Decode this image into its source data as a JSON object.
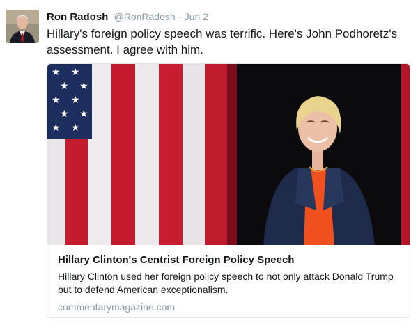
{
  "tweet": {
    "author_name": "Ron Radosh",
    "handle": "@RonRadosh",
    "separator": "·",
    "date": "Jun 2",
    "text": "Hillary's foreign policy speech was terrific. Here's John Podhoretz's assessment. I agree with him."
  },
  "card": {
    "title": "Hillary Clinton's Centrist Foreign Policy Speech",
    "description": "Hillary Clinton used her foreign policy speech to not only attack Donald Trump but to defend American exceptionalism.",
    "domain": "commentarymagazine.com"
  },
  "colors": {
    "name": "#14171a",
    "muted": "#8899a6",
    "flag_red": "#c8102e",
    "flag_blue": "#1c2d5e",
    "jacket": "#1e2a4a",
    "blouse": "#f0501e"
  }
}
